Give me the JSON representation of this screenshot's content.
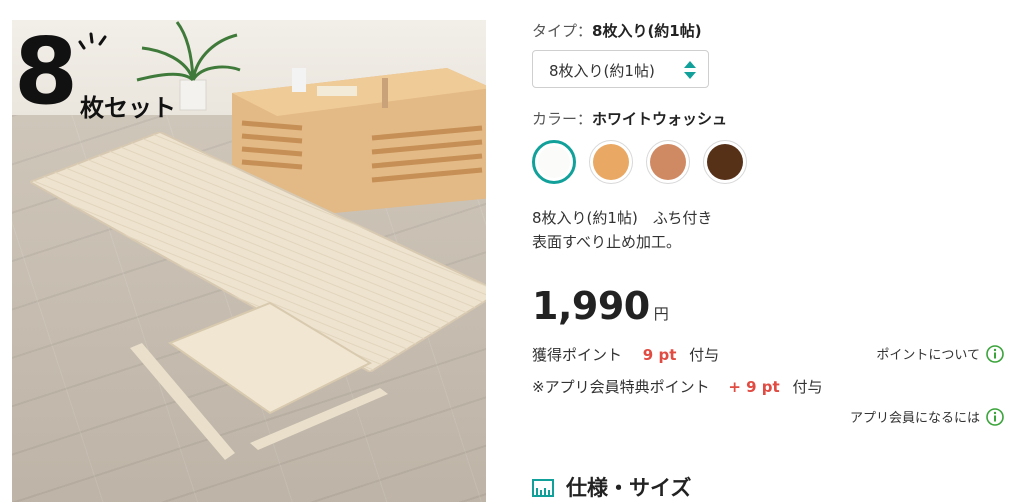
{
  "image": {
    "badge_number": "8",
    "badge_label": "枚セット"
  },
  "type_row": {
    "label": "タイプ：",
    "value": "8枚入り(約1帖)"
  },
  "type_select": {
    "selected": "8枚入り(約1帖)"
  },
  "color_row": {
    "label": "カラー：",
    "value": "ホワイトウォッシュ"
  },
  "swatches": [
    {
      "name": "white",
      "color": "#fbfbf9",
      "selected": true
    },
    {
      "name": "light-orange",
      "color": "#e9a863"
    },
    {
      "name": "terracotta",
      "color": "#d08a63"
    },
    {
      "name": "dark-brown",
      "color": "#573018"
    }
  ],
  "description": {
    "line1": "8枚入り(約1帖)　ふち付き",
    "line2": "表面すべり止め加工。"
  },
  "price": {
    "amount": "1,990",
    "unit": "円"
  },
  "points": {
    "label": "獲得ポイント",
    "value": "9 pt",
    "suffix": "付与",
    "link": "ポイントについて"
  },
  "app_points": {
    "label": "※アプリ会員特典ポイント",
    "value": "+ 9 pt",
    "suffix": "付与",
    "link": "アプリ会員になるには"
  },
  "spec": {
    "heading": "仕様・サイズ"
  },
  "colors": {
    "accent": "#11a09a",
    "point_red": "#e04b42"
  }
}
